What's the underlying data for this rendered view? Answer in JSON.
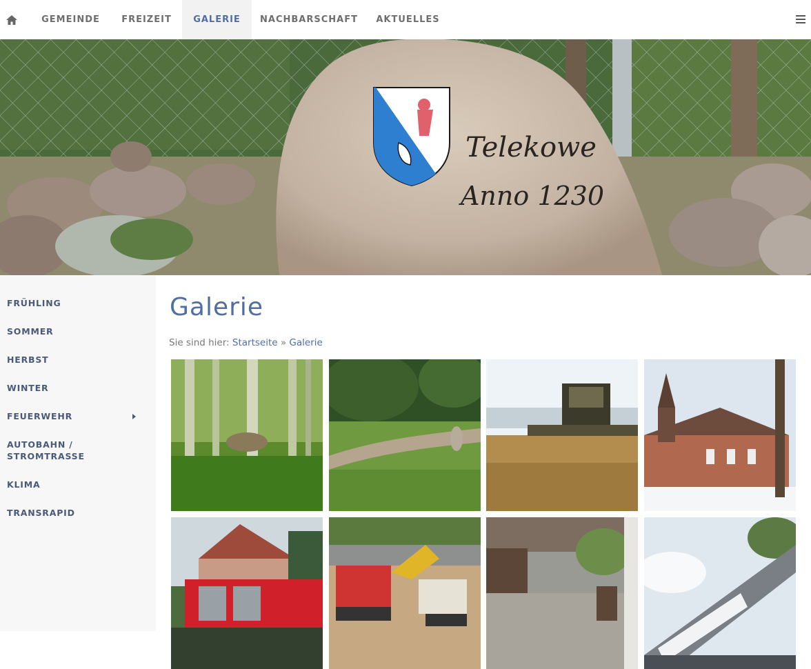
{
  "nav": {
    "home_icon": "home-icon",
    "items": [
      {
        "label": "GEMEINDE",
        "active": false
      },
      {
        "label": "FREIZEIT",
        "active": false
      },
      {
        "label": "GALERIE",
        "active": true
      },
      {
        "label": "NACHBARSCHAFT",
        "active": false
      },
      {
        "label": "AKTUELLES",
        "active": false
      }
    ],
    "menu_icon": "hamburger-menu-icon"
  },
  "hero": {
    "stone_line1": "Telekowe",
    "stone_line2": "Anno 1230"
  },
  "sidebar": {
    "items": [
      {
        "label": "FRÜHLING"
      },
      {
        "label": "SOMMER"
      },
      {
        "label": "HERBST"
      },
      {
        "label": "WINTER"
      },
      {
        "label": "FEUERWEHR",
        "has_submenu": true
      },
      {
        "label": "AUTOBAHN / STROMTRASSE"
      },
      {
        "label": "KLIMA"
      },
      {
        "label": "TRANSRAPID"
      }
    ]
  },
  "main": {
    "title": "Galerie",
    "breadcrumb": {
      "prefix": "Sie sind hier:",
      "home": "Startseite",
      "separator": "»",
      "current": "Galerie"
    }
  },
  "colors": {
    "accent": "#4f6ea6",
    "nav_text": "#6e6e6e",
    "sidebar_bg": "#f7f7f7",
    "sidebar_text": "#4a5a78"
  }
}
